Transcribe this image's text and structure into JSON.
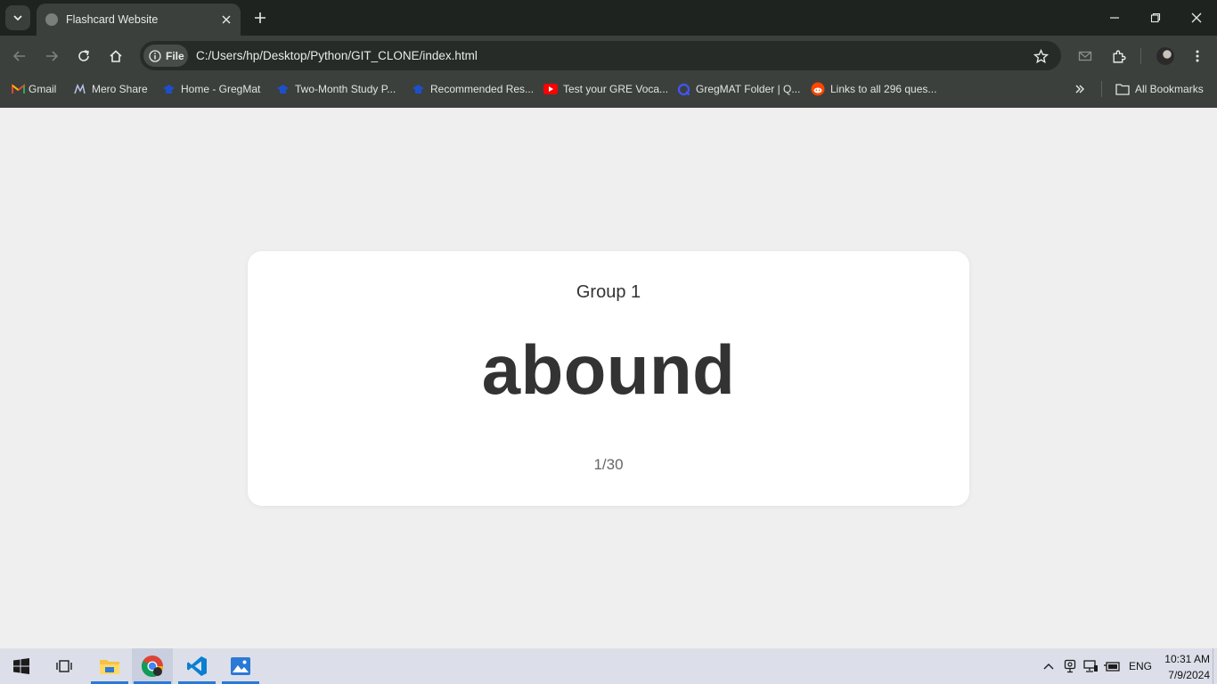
{
  "browser": {
    "tab": {
      "title": "Flashcard Website"
    },
    "address": {
      "chip_label": "File",
      "url": "C:/Users/hp/Desktop/Python/GIT_CLONE/index.html"
    },
    "bookmarks": [
      {
        "label": "Gmail",
        "icon": "gmail-icon"
      },
      {
        "label": "Mero Share",
        "icon": "meroshare-icon"
      },
      {
        "label": "Home - GregMat",
        "icon": "gregmat-icon"
      },
      {
        "label": "Two-Month Study P...",
        "icon": "gregmat-icon"
      },
      {
        "label": "Recommended Res...",
        "icon": "gregmat-icon"
      },
      {
        "label": "Test your GRE Voca...",
        "icon": "youtube-icon"
      },
      {
        "label": "GregMAT Folder | Q...",
        "icon": "quizlet-icon"
      },
      {
        "label": "Links to all 296 ques...",
        "icon": "reddit-icon"
      }
    ],
    "all_bookmarks_label": "All Bookmarks"
  },
  "flashcard": {
    "group": "Group 1",
    "word": "abound",
    "counter": "1/30"
  },
  "taskbar": {
    "apps": [
      "start-icon",
      "task-view-icon",
      "file-explorer-icon",
      "chrome-icon",
      "vscode-icon",
      "photos-icon"
    ],
    "language": "ENG",
    "time": "10:31 AM",
    "date": "7/9/2024"
  },
  "colors": {
    "accent": "#2b79d6",
    "page_background": "#efefef",
    "card_background": "#ffffff",
    "browser_frame": "#3b403c"
  }
}
